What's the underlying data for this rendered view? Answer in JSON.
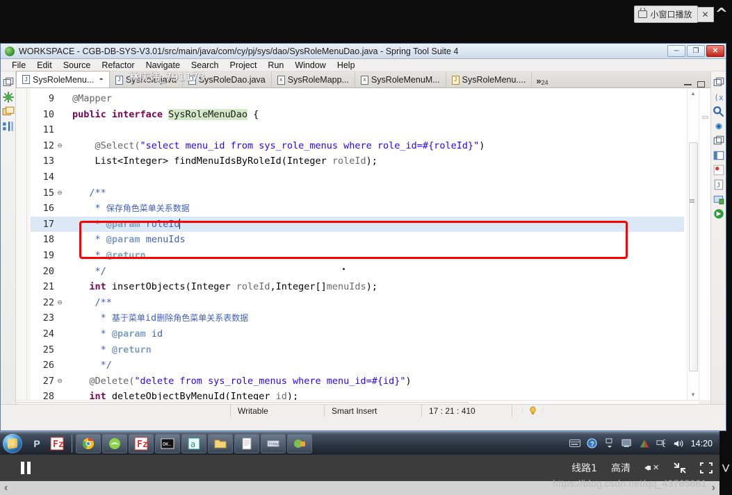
{
  "video_player": {
    "pip_button_label": "小窗口播放",
    "pip_close_label": "✕",
    "collapse_up_icon": "chevron-up",
    "pause_icon": "pause",
    "route_label": "线路1",
    "quality_label": "高清",
    "mute_icon": "volume-mute",
    "expand_icon": "shrink-arrows",
    "fullscreen_icon": "fullscreen",
    "collapse_down_icon": "chevron-down",
    "prev_page_icon": "‹",
    "next_page_icon": "›"
  },
  "watermarks": {
    "name": "林庆炜_791173",
    "url": "https://blog.csdn.net/qq_43765881"
  },
  "eclipse": {
    "title": "WORKSPACE - CGB-DB-SYS-V3.01/src/main/java/com/cy/pj/sys/dao/SysRoleMenuDao.java - Spring Tool Suite 4",
    "window_buttons": {
      "minimize": "─",
      "restore": "❐",
      "close": "✕"
    },
    "menu": [
      "File",
      "Edit",
      "Source",
      "Refactor",
      "Navigate",
      "Search",
      "Project",
      "Run",
      "Window",
      "Help"
    ],
    "tabs": [
      {
        "label": "SysRoleMenu...",
        "icon": "java-file-icon",
        "active": true,
        "closeable": true
      },
      {
        "label": "SysRole.java",
        "icon": "java-file-icon",
        "active": false,
        "closeable": false
      },
      {
        "label": "SysRoleDao.java",
        "icon": "java-file-icon",
        "active": false,
        "closeable": false
      },
      {
        "label": "SysRoleMapp...",
        "icon": "xml-file-icon",
        "active": false,
        "closeable": false
      },
      {
        "label": "SysRoleMenuM...",
        "icon": "xml-file-icon",
        "active": false,
        "closeable": false
      },
      {
        "label": "SysRoleMenu....",
        "icon": "warning-java-file-icon",
        "active": false,
        "closeable": false
      }
    ],
    "tabs_overflow": {
      "chevrons": "»",
      "count": "24"
    },
    "editor_buttons": {
      "minimize": "minimize-icon",
      "maximize": "maximize-icon"
    },
    "status_bar": {
      "writable": "Writable",
      "insert_mode": "Smart Insert",
      "position": "17 : 21 : 410",
      "bulb_icon": "lightbulb-icon"
    },
    "code_lines": [
      {
        "num": "9",
        "fold": "",
        "segments": [
          {
            "t": "@Mapper",
            "c": "ann"
          }
        ]
      },
      {
        "num": "10",
        "fold": "",
        "segments": [
          {
            "t": "public interface ",
            "c": "kw"
          },
          {
            "t": "SysRoleMenuDao",
            "c": "cls"
          },
          {
            "t": " {",
            "c": "plain"
          }
        ]
      },
      {
        "num": "11",
        "fold": "",
        "segments": []
      },
      {
        "num": "12",
        "fold": "⊖",
        "segments": [
          {
            "t": "    @Select(",
            "c": "ann"
          },
          {
            "t": "\"select menu_id from sys_role_menus where role_id=#{roleId}\"",
            "c": "str"
          },
          {
            "t": ")",
            "c": "plain"
          }
        ]
      },
      {
        "num": "13",
        "fold": "",
        "segments": [
          {
            "t": "    List<Integer> findMenuIdsByRoleId(Integer ",
            "c": "plain"
          },
          {
            "t": "roleId",
            "c": "prm"
          },
          {
            "t": ");",
            "c": "plain"
          }
        ]
      },
      {
        "num": "14",
        "fold": "",
        "segments": []
      },
      {
        "num": "15",
        "fold": "⊖",
        "segments": [
          {
            "t": "   /**",
            "c": "cmt"
          }
        ]
      },
      {
        "num": "16",
        "fold": "",
        "segments": [
          {
            "t": "    * ",
            "c": "cmt"
          },
          {
            "t": "保存角色菜单关系数据",
            "c": "cmt-cn"
          }
        ]
      },
      {
        "num": "17",
        "fold": "",
        "segments": [
          {
            "t": "    * ",
            "c": "cmt"
          },
          {
            "t": "@param",
            "c": "jdoc-tag"
          },
          {
            "t": " roleId",
            "c": "cmt"
          }
        ],
        "highlight": true,
        "caret": true
      },
      {
        "num": "18",
        "fold": "",
        "segments": [
          {
            "t": "    * ",
            "c": "cmt"
          },
          {
            "t": "@param",
            "c": "jdoc-tag"
          },
          {
            "t": " menuIds",
            "c": "cmt"
          }
        ]
      },
      {
        "num": "19",
        "fold": "",
        "segments": [
          {
            "t": "    * ",
            "c": "cmt"
          },
          {
            "t": "@return",
            "c": "jdoc-tag"
          }
        ]
      },
      {
        "num": "20",
        "fold": "",
        "segments": [
          {
            "t": "    */",
            "c": "cmt"
          }
        ]
      },
      {
        "num": "21",
        "fold": "",
        "segments": [
          {
            "t": "   int ",
            "c": "kw"
          },
          {
            "t": "insertObjects(Integer ",
            "c": "plain"
          },
          {
            "t": "roleId",
            "c": "prm"
          },
          {
            "t": ",Integer[]",
            "c": "plain"
          },
          {
            "t": "menuIds",
            "c": "prm"
          },
          {
            "t": ");",
            "c": "plain"
          }
        ]
      },
      {
        "num": "22",
        "fold": "⊖",
        "segments": [
          {
            "t": "    /**",
            "c": "cmt"
          }
        ]
      },
      {
        "num": "23",
        "fold": "",
        "segments": [
          {
            "t": "     * ",
            "c": "cmt"
          },
          {
            "t": "基于菜单",
            "c": "cmt-cn"
          },
          {
            "t": "id",
            "c": "cmt"
          },
          {
            "t": "删除角色菜单关系表数据",
            "c": "cmt-cn"
          }
        ]
      },
      {
        "num": "24",
        "fold": "",
        "segments": [
          {
            "t": "     * ",
            "c": "cmt"
          },
          {
            "t": "@param",
            "c": "jdoc-tag"
          },
          {
            "t": " id",
            "c": "cmt"
          }
        ]
      },
      {
        "num": "25",
        "fold": "",
        "segments": [
          {
            "t": "     * ",
            "c": "cmt"
          },
          {
            "t": "@return",
            "c": "jdoc-tag"
          }
        ]
      },
      {
        "num": "26",
        "fold": "",
        "segments": [
          {
            "t": "     */",
            "c": "cmt"
          }
        ]
      },
      {
        "num": "27",
        "fold": "⊖",
        "segments": [
          {
            "t": "   @Delete(",
            "c": "ann"
          },
          {
            "t": "\"delete from sys_role_menus where menu_id=#{id}\"",
            "c": "str"
          },
          {
            "t": ")",
            "c": "plain"
          }
        ]
      },
      {
        "num": "28",
        "fold": "",
        "segments": [
          {
            "t": "   int ",
            "c": "kw"
          },
          {
            "t": "deleteObjectByMenuId(Integer ",
            "c": "plain"
          },
          {
            "t": "id",
            "c": "prm"
          },
          {
            "t": ");",
            "c": "plain"
          }
        ]
      }
    ],
    "annotation_box": {
      "color": "#ff0000",
      "covers_lines": "12-13"
    }
  },
  "taskbar": {
    "start_icon": "windows-start-orb",
    "quick_launch": [
      "p-icon",
      "filezilla-icon"
    ],
    "items": [
      "chrome-icon",
      "browser-icon",
      "filezilla-icon",
      "terminal-icon",
      "editplus-icon",
      "folder-icon",
      "notepad-icon",
      "app-icon",
      "tool-icon"
    ],
    "tray": [
      "keyboard-icon",
      "help-icon",
      "show-desktop-icon",
      "triangle-icon",
      "network-icon",
      "volume-icon"
    ],
    "clock": "14:20"
  }
}
